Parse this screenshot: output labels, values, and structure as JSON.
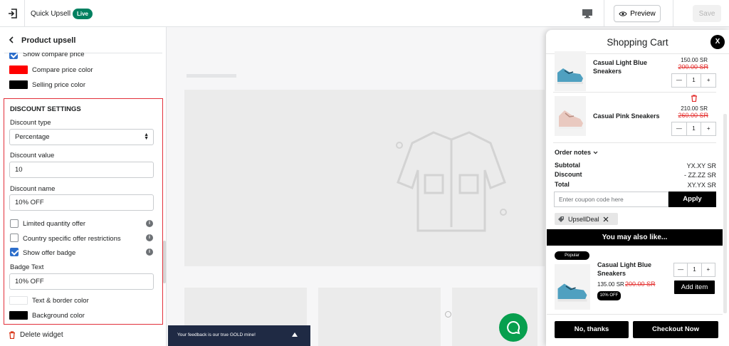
{
  "topbar": {
    "app_name": "Quick Upsell",
    "live_badge": "Live",
    "preview_label": "Preview",
    "save_label": "Save"
  },
  "sidebar": {
    "title": "Product upsell",
    "show_compare_price": "Show compare price",
    "compare_price_color": "Compare price color",
    "selling_price_color": "Selling price color",
    "colors": {
      "compare": "#ff0000",
      "selling": "#000000",
      "text_border": "#ffffff",
      "background": "#000000"
    },
    "discount": {
      "section_title": "DISCOUNT SETTINGS",
      "type_label": "Discount type",
      "type_value": "Percentage",
      "value_label": "Discount value",
      "value": "10",
      "name_label": "Discount name",
      "name_value": "10% OFF",
      "limited_qty": "Limited quantity offer",
      "country_restrict": "Country specific offer restrictions",
      "show_badge": "Show offer badge",
      "badge_text_label": "Badge Text",
      "badge_text_value": "10% OFF",
      "text_border_color": "Text & border color",
      "background_color": "Background color"
    },
    "delete_label": "Delete widget"
  },
  "canvas": {
    "feedback_text": "Your feedback is our true GOLD mine!"
  },
  "cart": {
    "title": "Shopping Cart",
    "close": "X",
    "items": [
      {
        "name_line1": "Casual Light Blue",
        "name_line2": "Sneakers",
        "price": "150.00 SR",
        "compare": "200.00 SR",
        "qty": "1"
      },
      {
        "name_line1": "Casual Pink Sneakers",
        "name_line2": "",
        "price": "210.00 SR",
        "compare": "260.00 SR",
        "qty": "1"
      }
    ],
    "order_notes": "Order notes",
    "subtotal_label": "Subtotal",
    "subtotal_value": "YX.XY SR",
    "discount_label": "Discount",
    "discount_value": "- ZZ.ZZ SR",
    "total_label": "Total",
    "total_value": "XY.YX SR",
    "coupon_placeholder": "Enter coupon code here",
    "apply_label": "Apply",
    "applied_code": "UpsellDeal",
    "upsell_heading": "You may also like...",
    "upsell": {
      "badge": "Popular",
      "name_line1": "Casual Light Blue",
      "name_line2": "Sneakers",
      "price": "135.00 SR",
      "compare": "200.00 SR",
      "offer_badge": "10% OFF",
      "qty": "1",
      "add_label": "Add item"
    },
    "no_thanks_label": "No, thanks",
    "checkout_label": "Checkout Now"
  }
}
